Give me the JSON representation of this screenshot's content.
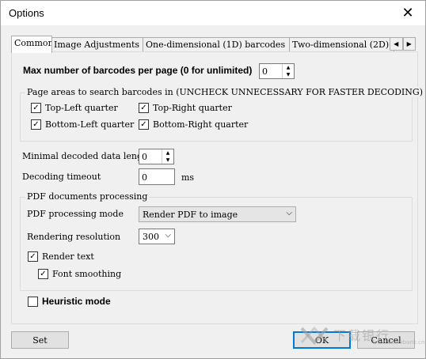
{
  "window": {
    "title": "Options",
    "close_glyph": "✕"
  },
  "tabs": [
    {
      "label": "Common"
    },
    {
      "label": "Image Adjustments"
    },
    {
      "label": "One-dimensional (1D) barcodes"
    },
    {
      "label": "Two-dimensional (2D)"
    }
  ],
  "tab_scroll": {
    "left": "◀",
    "right": "▶"
  },
  "common": {
    "max_barcodes_label": "Max number of barcodes per page (0 for unlimited)",
    "max_barcodes_value": "0",
    "page_areas_title": "Page areas to search barcodes in (UNCHECK UNNECESSARY FOR FASTER DECODING)",
    "areas": {
      "top_left": "Top-Left quarter",
      "top_right": "Top-Right quarter",
      "bottom_left": "Bottom-Left quarter",
      "bottom_right": "Bottom-Right quarter"
    },
    "min_length_label": "Minimal decoded data leng",
    "min_length_value": "0",
    "timeout_label": "Decoding timeout",
    "timeout_value": "0",
    "timeout_unit": "ms",
    "pdf_group_title": "PDF documents processing",
    "pdf_mode_label": "PDF processing mode",
    "pdf_mode_value": "Render PDF to image",
    "render_res_label": "Rendering resolution",
    "render_res_value": "300",
    "render_text_label": "Render text",
    "font_smoothing_label": "Font smoothing",
    "heuristic_label": "Heuristic mode"
  },
  "checkmark": "✓",
  "caret": "⌵",
  "spin_up": "▲",
  "spin_down": "▼",
  "buttons": {
    "set": "Set",
    "ok": "OK",
    "cancel": "Cancel"
  },
  "watermark": {
    "text": "下载银行",
    "sub": "www.downbank.cn"
  }
}
